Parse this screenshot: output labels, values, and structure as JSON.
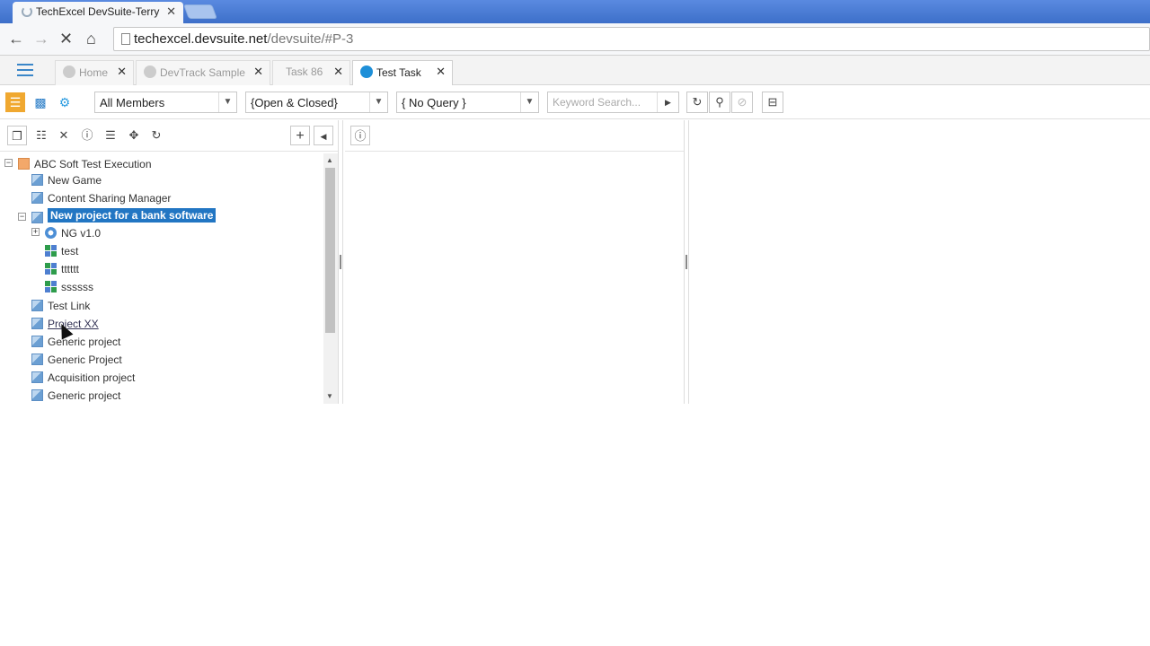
{
  "browser": {
    "tab_title": "TechExcel DevSuite-Terry",
    "url_host": "techexcel.devsuite.net",
    "url_path": "/devsuite/#P-3"
  },
  "app_tabs": [
    {
      "label": "Home"
    },
    {
      "label": "DevTrack Sample"
    },
    {
      "label": "Task 86"
    },
    {
      "label": "Test Task"
    }
  ],
  "filters": {
    "members": "All Members",
    "status": "{Open & Closed}",
    "query": "{ No Query }",
    "keyword_placeholder": "Keyword Search..."
  },
  "tree": {
    "items": [
      {
        "label": "ABC Soft Test Execution"
      },
      {
        "label": "New Game"
      },
      {
        "label": "Content Sharing Manager"
      },
      {
        "label": "New project for a bank software"
      },
      {
        "label": "NG v1.0"
      },
      {
        "label": "test"
      },
      {
        "label": "tttttt"
      },
      {
        "label": "ssssss"
      },
      {
        "label": "Test Link"
      },
      {
        "label": "Project XX"
      },
      {
        "label": "Generic project"
      },
      {
        "label": "Generic Project"
      },
      {
        "label": "Acquisition project"
      },
      {
        "label": "Generic project"
      }
    ]
  },
  "colors": {
    "accent": "#2276c3",
    "browser_bar": "#4a7cd4"
  }
}
